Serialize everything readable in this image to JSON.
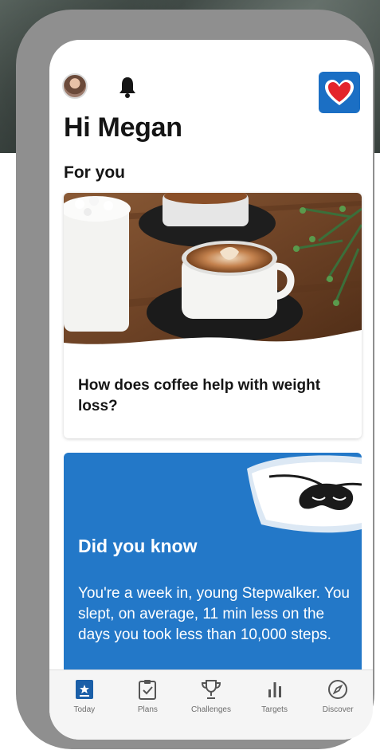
{
  "header": {
    "greeting": "Hi Megan",
    "icons": {
      "avatar": "user-avatar",
      "notifications": "bell-icon",
      "app": "heart-logo-icon"
    }
  },
  "for_you": {
    "title": "For you",
    "article": {
      "title": "How does coffee help with weight loss?",
      "image": "coffee-cups-photo"
    }
  },
  "did_you_know": {
    "title": "Did you know",
    "body": "You're a week in, young Stepwalker. You slept, on average, 11 min less on the days you took less than 10,000 steps.",
    "illustration": "pillow-sleep-mask-icon"
  },
  "nav": {
    "items": [
      {
        "label": "Today",
        "icon": "today-icon"
      },
      {
        "label": "Plans",
        "icon": "clipboard-check-icon"
      },
      {
        "label": "Challenges",
        "icon": "trophy-icon"
      },
      {
        "label": "Targets",
        "icon": "bar-chart-icon"
      },
      {
        "label": "Discover",
        "icon": "compass-icon"
      }
    ]
  },
  "colors": {
    "accent_blue": "#2378c8",
    "logo_blue": "#1b6fc4",
    "heart_red": "#e3242b",
    "text_dark": "#151515",
    "nav_gray": "#6d6d6d"
  }
}
